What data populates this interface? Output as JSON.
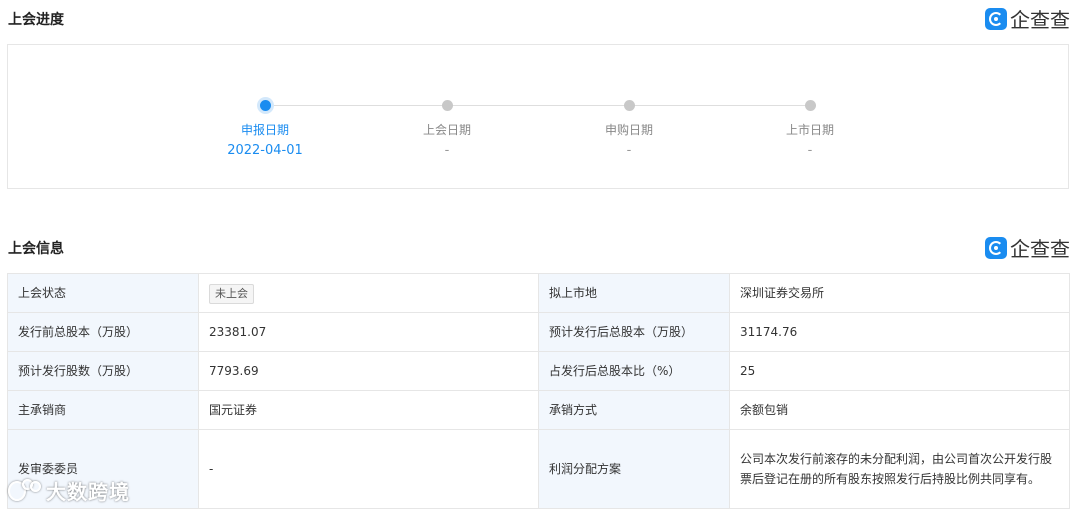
{
  "progress_section": {
    "title": "上会进度",
    "logo_text": "企查查",
    "steps": [
      {
        "label": "申报日期",
        "value": "2022-04-01",
        "active": true
      },
      {
        "label": "上会日期",
        "value": "-",
        "active": false
      },
      {
        "label": "申购日期",
        "value": "-",
        "active": false
      },
      {
        "label": "上市日期",
        "value": "-",
        "active": false
      }
    ]
  },
  "info_section": {
    "title": "上会信息",
    "logo_text": "企查查",
    "rows": [
      {
        "k1": "上会状态",
        "v1": "未上会",
        "k2": "拟上市地",
        "v2": "深圳证券交易所"
      },
      {
        "k1": "发行前总股本（万股）",
        "v1": "23381.07",
        "k2": "预计发行后总股本（万股）",
        "v2": "31174.76"
      },
      {
        "k1": "预计发行股数（万股）",
        "v1": "7793.69",
        "k2": "占发行后总股本比（%）",
        "v2": "25"
      },
      {
        "k1": "主承销商",
        "v1": "国元证券",
        "k2": "承销方式",
        "v2": "余额包销"
      },
      {
        "k1": "发审委委员",
        "v1": "-",
        "k2": "利润分配方案",
        "v2": "公司本次发行前滚存的未分配利润，由公司首次公开发行股票后登记在册的所有股东按照发行后持股比例共同享有。"
      }
    ]
  },
  "watermark": {
    "text": "大数跨境"
  },
  "colors": {
    "accent": "#1a8cf0",
    "key_cell_bg": "#f2f7fd",
    "border": "#e6e6e6"
  }
}
